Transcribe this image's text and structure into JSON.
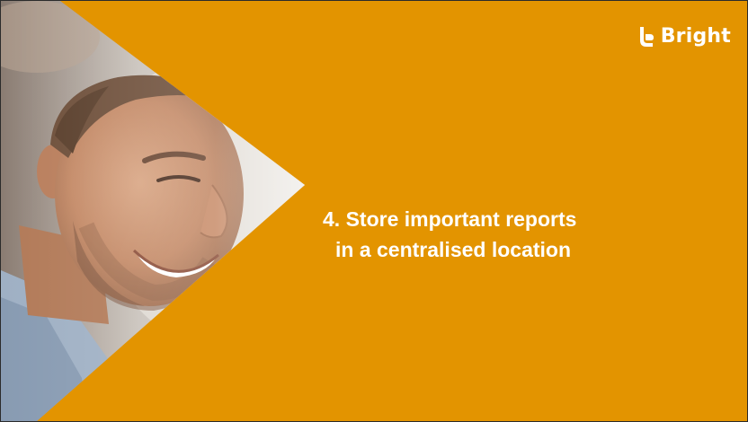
{
  "brand": {
    "name": "Bright",
    "icon": "bright-logo-icon",
    "color": "#FFFFFF"
  },
  "slide": {
    "background_color": "#E39400",
    "title_lines": [
      "4. Store important reports",
      "in a centralised location"
    ],
    "photo": "smiling-man-photo"
  }
}
